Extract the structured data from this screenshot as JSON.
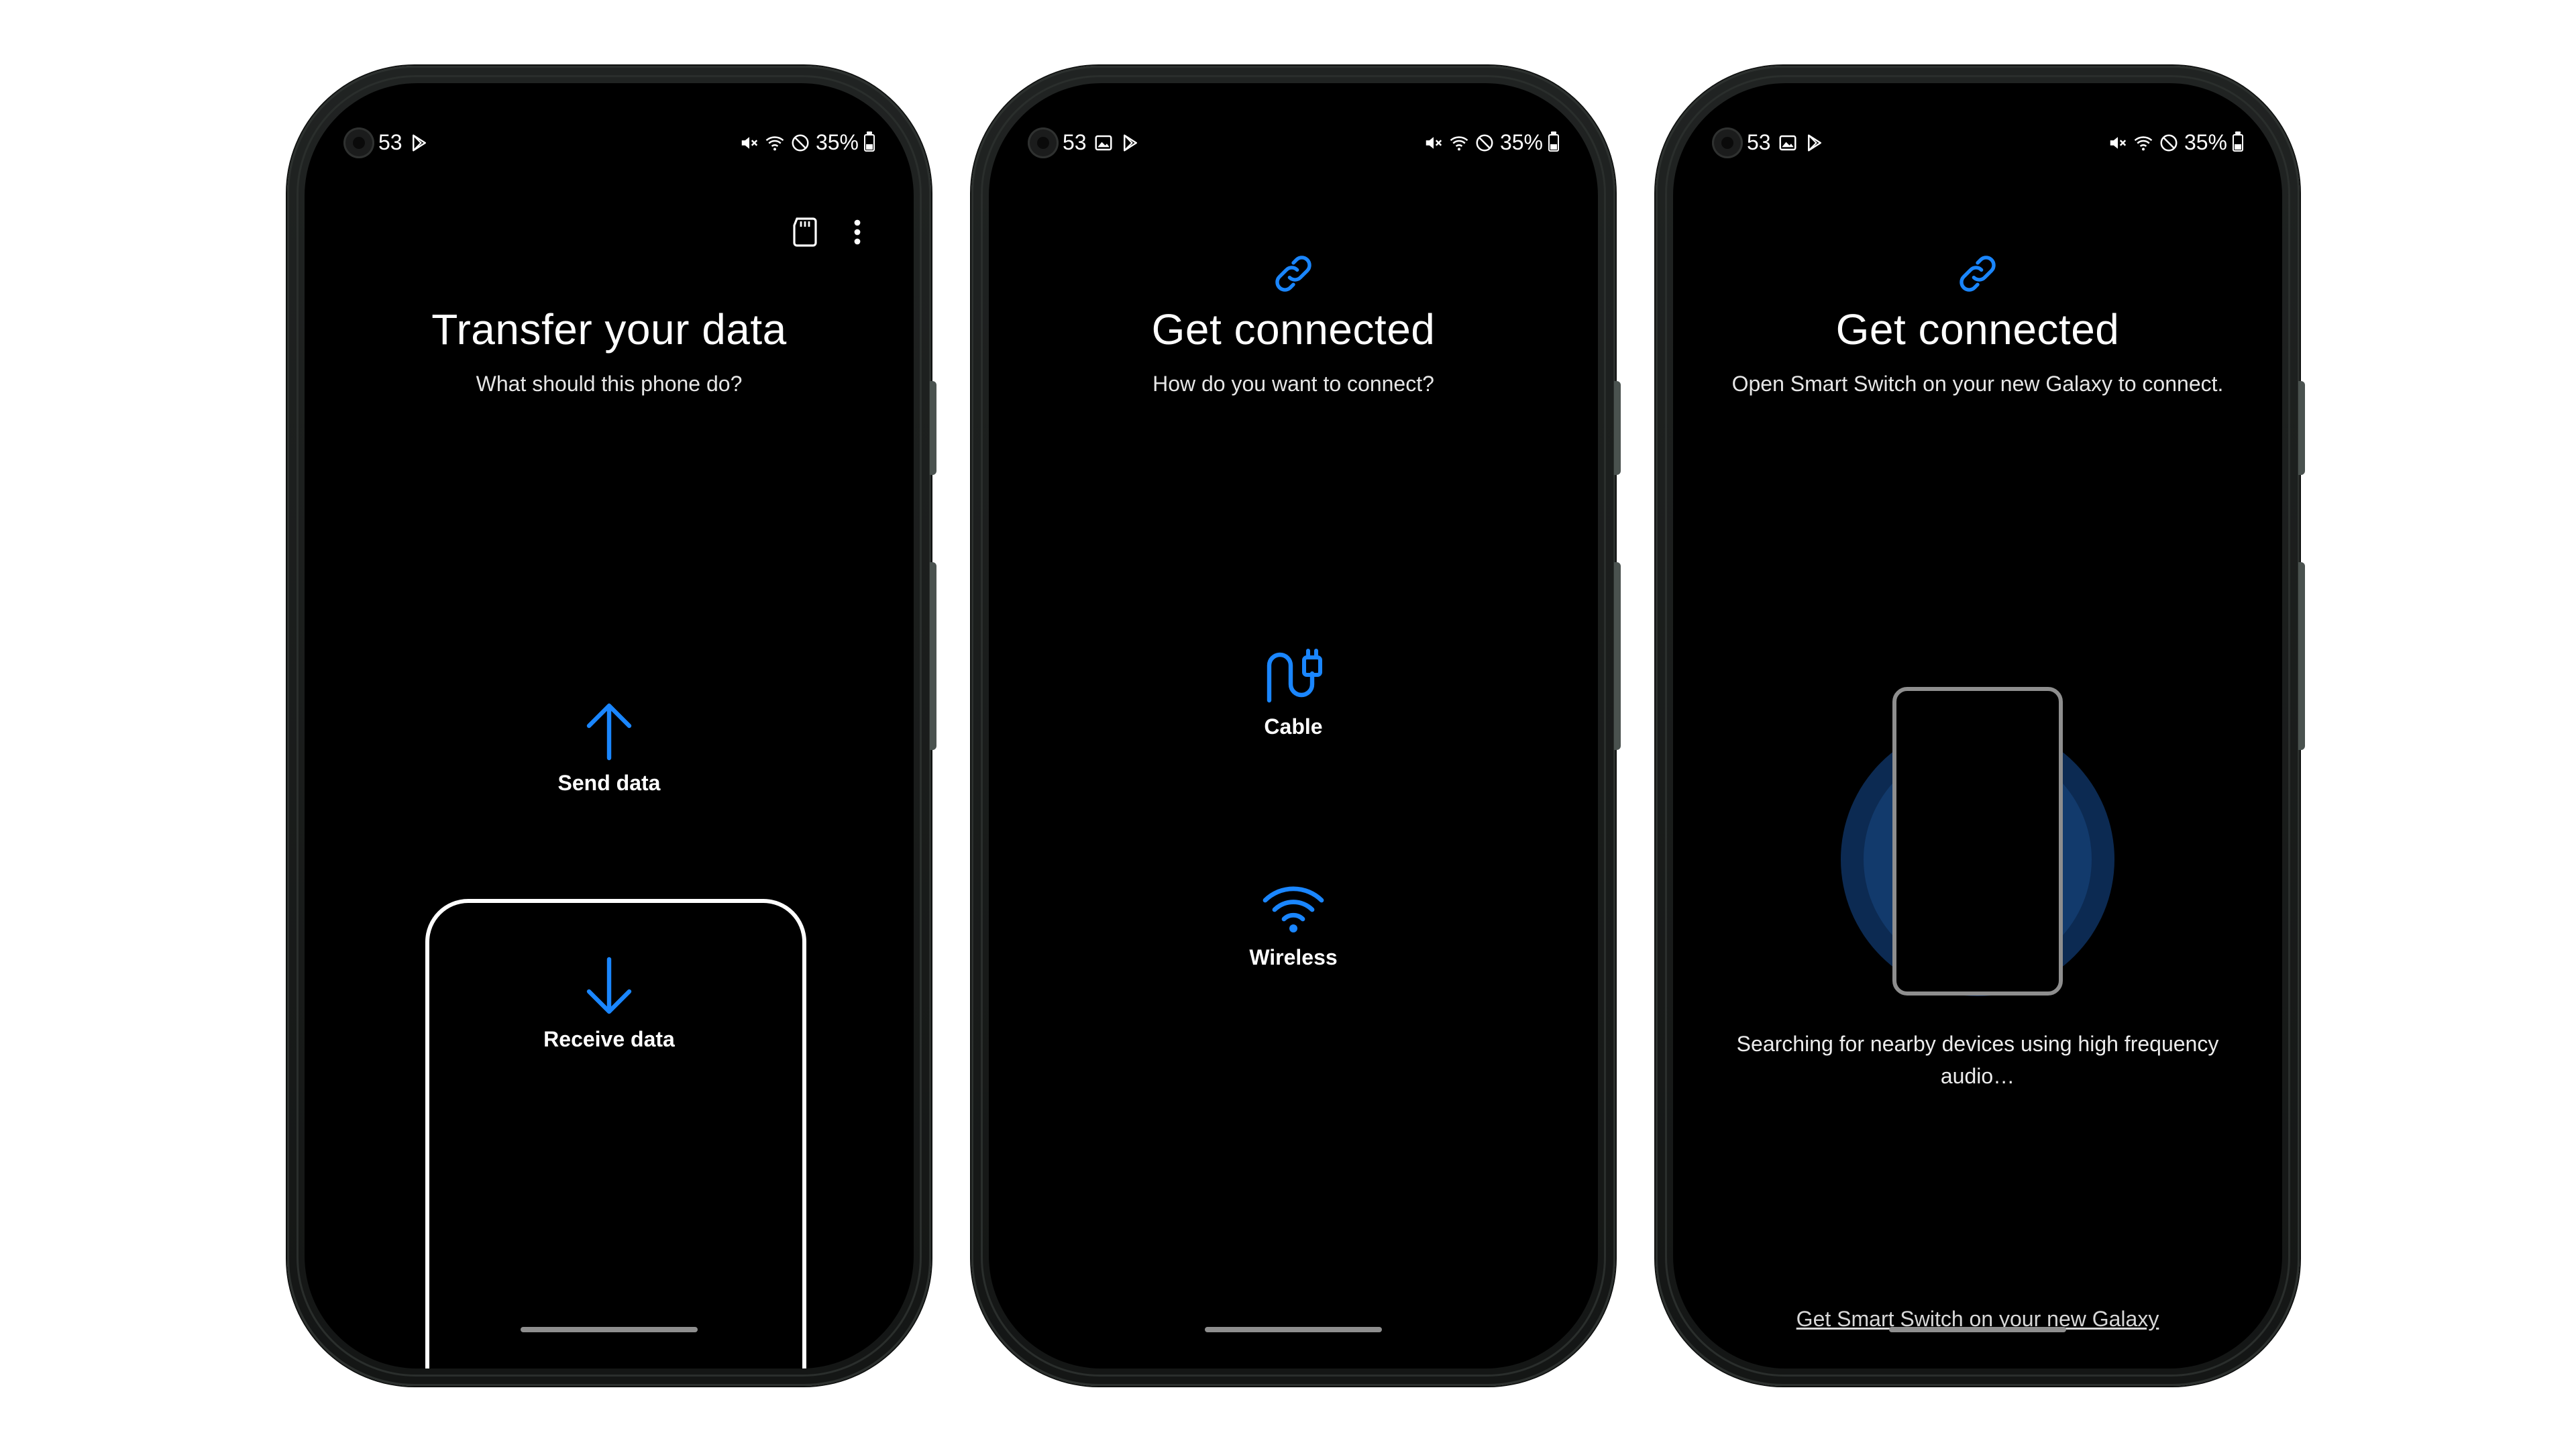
{
  "colors": {
    "accent": "#1a86ff",
    "background": "#000000",
    "text": "#ffffff",
    "page": "#ffffff"
  },
  "statusbar": [
    {
      "time_fragment": "53",
      "icons": [
        "play-store-icon"
      ],
      "battery": "35%"
    },
    {
      "time_fragment": "53",
      "icons": [
        "gallery-icon",
        "play-store-icon"
      ],
      "battery": "35%"
    },
    {
      "time_fragment": "53",
      "icons": [
        "gallery-icon",
        "play-store-icon"
      ],
      "battery": "35%"
    }
  ],
  "screen1": {
    "title": "Transfer your data",
    "subtitle": "What should this phone do?",
    "toolbar_icons": [
      "sd-card-icon",
      "more-options-icon"
    ],
    "options": [
      {
        "label": "Send data",
        "icon": "arrow-up-icon"
      },
      {
        "label": "Receive data",
        "icon": "arrow-down-icon"
      }
    ]
  },
  "screen2": {
    "icon": "link-icon",
    "title": "Get connected",
    "subtitle": "How do you want to connect?",
    "options": [
      {
        "label": "Cable",
        "icon": "cable-icon"
      },
      {
        "label": "Wireless",
        "icon": "wifi-icon"
      }
    ]
  },
  "screen3": {
    "icon": "link-icon",
    "title": "Get connected",
    "subtitle": "Open Smart Switch on your new Galaxy to connect.",
    "status": "Searching for nearby devices using high frequency audio…",
    "footer_link": "Get Smart Switch on your new Galaxy"
  }
}
